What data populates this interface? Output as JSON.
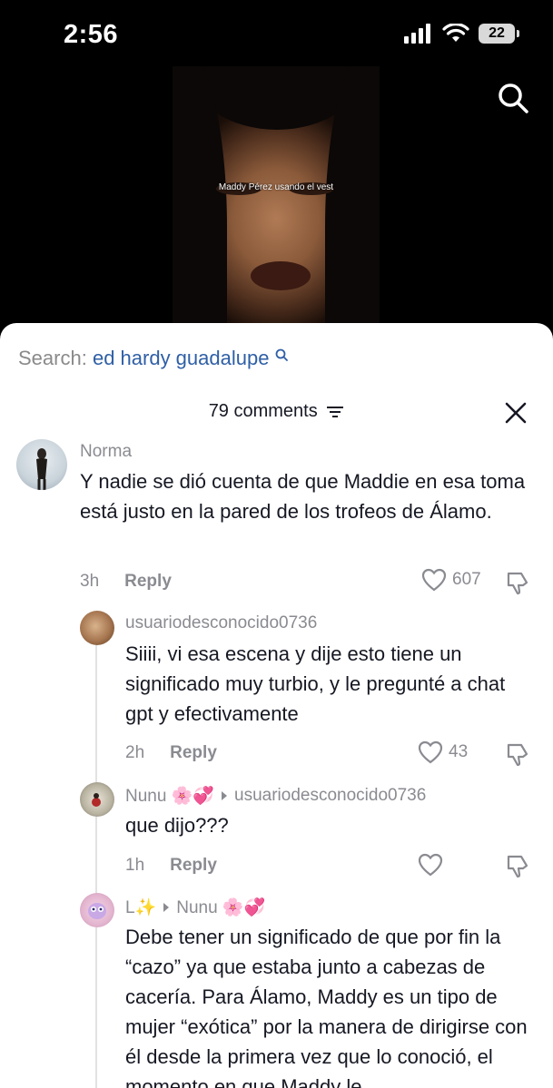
{
  "status": {
    "time": "2:56",
    "battery": "22"
  },
  "video": {
    "subtitle": "Maddy Pérez usando el vest"
  },
  "search": {
    "label": "Search:",
    "query": "ed hardy guadalupe"
  },
  "comments_header": {
    "count_label": "79 comments"
  },
  "comments": [
    {
      "user": "Norma",
      "text": "Y nadie se dió cuenta de que Maddie en esa toma está justo en la pared de los trofeos de Álamo.",
      "time": "3h",
      "reply": "Reply",
      "likes": "607"
    },
    {
      "user": "usuariodesconocido0736",
      "text": "Siiii, vi esa escena y dije esto tiene un significado muy turbio, y le pregunté a chat gpt y efectivamente",
      "time": "2h",
      "reply": "Reply",
      "likes": "43"
    },
    {
      "user": "Nunu 🌸💞",
      "reply_to": "usuariodesconocido0736",
      "text": "que dijo???",
      "time": "1h",
      "reply": "Reply",
      "likes": ""
    },
    {
      "user": "L✨",
      "reply_to": "Nunu 🌸💞",
      "text": "Debe tener un significado de que por fin la “cazo” ya que estaba junto a cabezas de cacería. Para Álamo, Maddy es un tipo de mujer “exótica” por la manera de dirigirse con él desde la primera vez que lo conoció, el momento en que Maddy le"
    }
  ],
  "colors": {
    "link": "#2f5fa6",
    "muted": "#8a8b91",
    "text": "#161823"
  }
}
